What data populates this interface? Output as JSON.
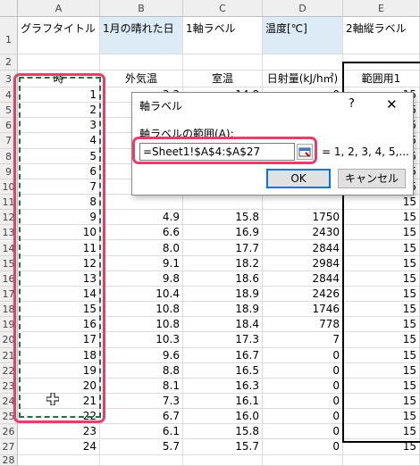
{
  "columns": [
    "A",
    "B",
    "C",
    "D",
    "E"
  ],
  "rows": [
    {
      "num": "1",
      "a": "グラフタイトル",
      "b": "1月の晴れた日",
      "c": "1軸ラベル",
      "d": "温度[℃]",
      "e": "2軸縦ラベル"
    },
    {
      "num": "2",
      "a": "",
      "b": "",
      "c": "",
      "d": "",
      "e": ""
    },
    {
      "num": "3",
      "a": "時",
      "b": "外気温",
      "c": "室温",
      "d": "日射量(kJ/h㎡)",
      "e": "範囲用1"
    },
    {
      "num": "4",
      "a": "1",
      "b": "3.3",
      "c": "14.8",
      "d": "0",
      "e": "15"
    },
    {
      "num": "5",
      "a": "2",
      "b": "",
      "c": "",
      "d": "",
      "e": "15"
    },
    {
      "num": "6",
      "a": "3",
      "b": "",
      "c": "",
      "d": "",
      "e": "15"
    },
    {
      "num": "7",
      "a": "4",
      "b": "",
      "c": "",
      "d": "",
      "e": "15"
    },
    {
      "num": "8",
      "a": "5",
      "b": "",
      "c": "",
      "d": "",
      "e": "15"
    },
    {
      "num": "9",
      "a": "6",
      "b": "",
      "c": "",
      "d": "",
      "e": "15"
    },
    {
      "num": "10",
      "a": "7",
      "b": "",
      "c": "",
      "d": "",
      "e": "15"
    },
    {
      "num": "11",
      "a": "8",
      "b": "",
      "c": "",
      "d": "",
      "e": "15"
    },
    {
      "num": "12",
      "a": "9",
      "b": "4.9",
      "c": "15.8",
      "d": "1750",
      "e": "15"
    },
    {
      "num": "13",
      "a": "10",
      "b": "6.6",
      "c": "16.9",
      "d": "2430",
      "e": "15"
    },
    {
      "num": "14",
      "a": "11",
      "b": "8.0",
      "c": "17.7",
      "d": "2844",
      "e": "15"
    },
    {
      "num": "15",
      "a": "12",
      "b": "9.1",
      "c": "18.2",
      "d": "2984",
      "e": "15"
    },
    {
      "num": "16",
      "a": "13",
      "b": "9.8",
      "c": "18.6",
      "d": "2844",
      "e": "15"
    },
    {
      "num": "17",
      "a": "14",
      "b": "10.4",
      "c": "18.9",
      "d": "2426",
      "e": "15"
    },
    {
      "num": "18",
      "a": "15",
      "b": "10.8",
      "c": "18.9",
      "d": "1746",
      "e": "15"
    },
    {
      "num": "19",
      "a": "16",
      "b": "10.8",
      "c": "18.4",
      "d": "778",
      "e": "15"
    },
    {
      "num": "20",
      "a": "17",
      "b": "10.3",
      "c": "17.3",
      "d": "7",
      "e": "15"
    },
    {
      "num": "21",
      "a": "18",
      "b": "9.6",
      "c": "16.7",
      "d": "0",
      "e": "15"
    },
    {
      "num": "22",
      "a": "19",
      "b": "8.8",
      "c": "16.5",
      "d": "0",
      "e": "15"
    },
    {
      "num": "23",
      "a": "20",
      "b": "8.1",
      "c": "16.3",
      "d": "0",
      "e": "15"
    },
    {
      "num": "24",
      "a": "21",
      "b": "7.3",
      "c": "16.1",
      "d": "0",
      "e": "15"
    },
    {
      "num": "25",
      "a": "22",
      "b": "6.7",
      "c": "16.0",
      "d": "0",
      "e": "15"
    },
    {
      "num": "26",
      "a": "23",
      "b": "6.1",
      "c": "15.8",
      "d": "0",
      "e": "15"
    },
    {
      "num": "27",
      "a": "24",
      "b": "5.7",
      "c": "15.7",
      "d": "0",
      "e": "15"
    },
    {
      "num": "28",
      "a": "",
      "b": "",
      "c": "",
      "d": "",
      "e": ""
    }
  ],
  "dialog": {
    "title": "軸ラベル",
    "help": "?",
    "close": "✕",
    "range_label": "軸ラベルの範囲(A):",
    "range_value": "=Sheet1!$A$4:$A$27",
    "preview": "= 1, 2, 3, 4, 5,...",
    "ok": "OK",
    "cancel": "キャンセル"
  },
  "colors": {
    "highlight": "#e83e6c",
    "selection_dash": "#217346",
    "header_fill": "#ddebf7"
  }
}
